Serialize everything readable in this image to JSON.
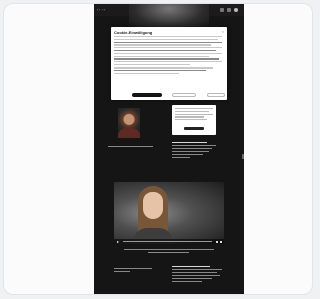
{
  "site": {
    "logo": "·· ··"
  },
  "cookie": {
    "title": "Cookie-Einwilligung",
    "close_glyph": "×",
    "accept_label": "",
    "reject_label": "",
    "settings_label": ""
  },
  "info": {
    "button_label": ""
  },
  "colors": {
    "page_bg": "#151515",
    "dialog_bg": "#ffffff",
    "frame_bg": "#f0f1f3"
  },
  "icons": [
    "search-icon",
    "account-icon",
    "play-icon",
    "close-icon"
  ]
}
